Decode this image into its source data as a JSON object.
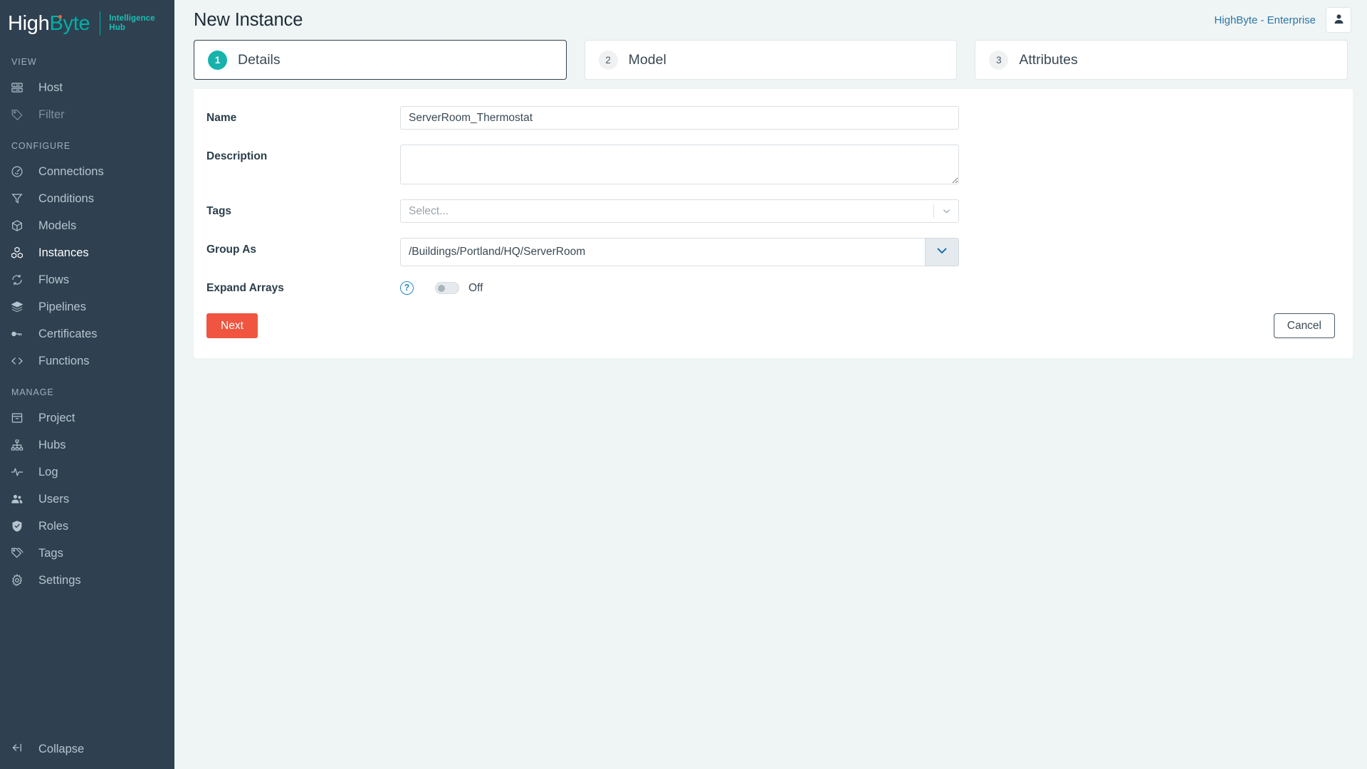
{
  "brand": {
    "name_first": "High",
    "name_second": "Byte",
    "sub_line1": "Intelligence",
    "sub_line2": "Hub",
    "accent_teal": "#00b0a6",
    "accent_dot": "#ef5c3f"
  },
  "sidebar": {
    "sections": [
      {
        "title": "VIEW",
        "items": [
          {
            "label": "Host",
            "icon": "server-icon",
            "state": "normal"
          },
          {
            "label": "Filter",
            "icon": "tag-icon",
            "state": "disabled"
          }
        ]
      },
      {
        "title": "CONFIGURE",
        "items": [
          {
            "label": "Connections",
            "icon": "plug-icon",
            "state": "normal"
          },
          {
            "label": "Conditions",
            "icon": "funnel-icon",
            "state": "normal"
          },
          {
            "label": "Models",
            "icon": "box-icon",
            "state": "normal"
          },
          {
            "label": "Instances",
            "icon": "cubes-icon",
            "state": "active"
          },
          {
            "label": "Flows",
            "icon": "refresh-icon",
            "state": "normal"
          },
          {
            "label": "Pipelines",
            "icon": "layers-icon",
            "state": "normal"
          },
          {
            "label": "Certificates",
            "icon": "key-icon",
            "state": "normal"
          },
          {
            "label": "Functions",
            "icon": "code-icon",
            "state": "normal"
          }
        ]
      },
      {
        "title": "MANAGE",
        "items": [
          {
            "label": "Project",
            "icon": "archive-icon",
            "state": "normal"
          },
          {
            "label": "Hubs",
            "icon": "sitemap-icon",
            "state": "normal"
          },
          {
            "label": "Log",
            "icon": "pulse-icon",
            "state": "normal"
          },
          {
            "label": "Users",
            "icon": "users-icon",
            "state": "normal"
          },
          {
            "label": "Roles",
            "icon": "shield-check-icon",
            "state": "normal"
          },
          {
            "label": "Tags",
            "icon": "tags-icon",
            "state": "normal"
          },
          {
            "label": "Settings",
            "icon": "gear-icon",
            "state": "normal"
          }
        ]
      }
    ],
    "collapse_label": "Collapse",
    "collapse_icon": "collapse-left-icon"
  },
  "topbar": {
    "title": "New Instance",
    "tenant": "HighByte - Enterprise",
    "avatar_icon": "user-icon"
  },
  "steps": [
    {
      "number": "1",
      "label": "Details",
      "active": true
    },
    {
      "number": "2",
      "label": "Model",
      "active": false
    },
    {
      "number": "3",
      "label": "Attributes",
      "active": false
    }
  ],
  "form": {
    "name": {
      "label": "Name",
      "value": "ServerRoom_Thermostat",
      "placeholder": ""
    },
    "description": {
      "label": "Description",
      "value": "",
      "placeholder": ""
    },
    "tags": {
      "label": "Tags",
      "placeholder": "Select...",
      "caret_icon": "chevron-down-icon"
    },
    "group_as": {
      "label": "Group As",
      "value": "/Buildings/Portland/HQ/ServerRoom",
      "placeholder": "",
      "button_icon": "chevron-down-icon"
    },
    "expand_arrays": {
      "label": "Expand Arrays",
      "help_icon": "question-circle-icon",
      "help_glyph": "?",
      "state_label": "Off",
      "enabled": false
    }
  },
  "actions": {
    "next_label": "Next",
    "cancel_label": "Cancel",
    "next_color": "#ef5540"
  }
}
